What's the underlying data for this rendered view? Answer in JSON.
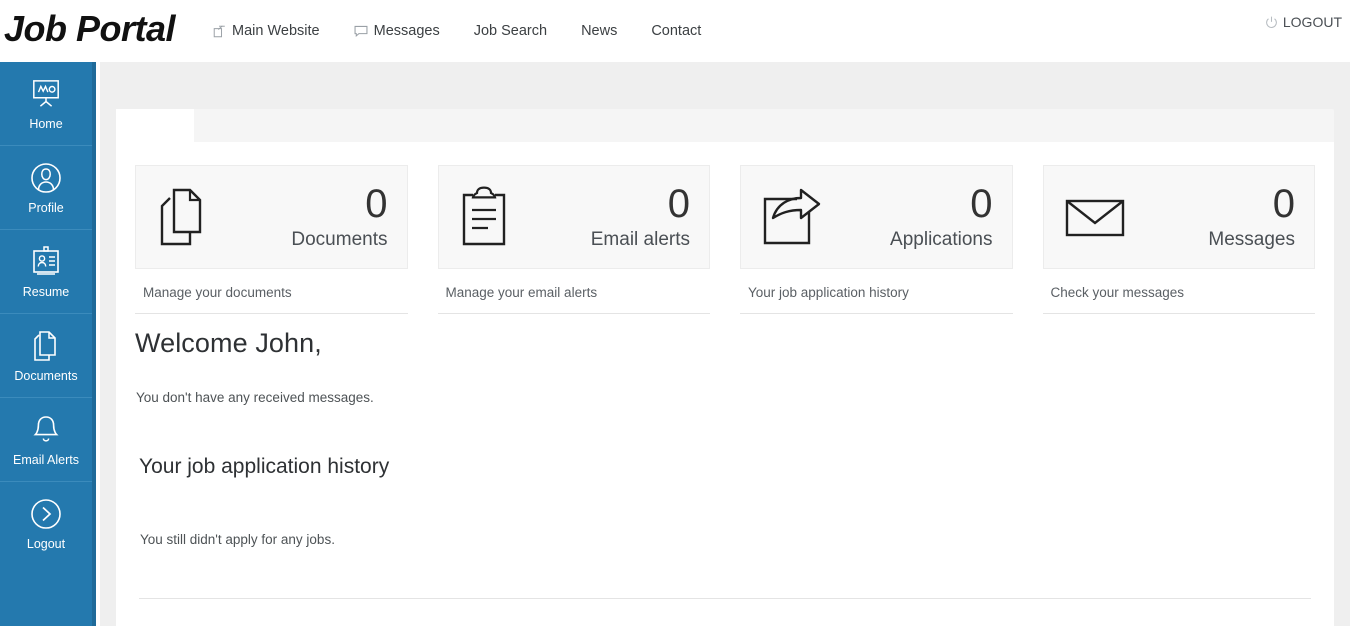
{
  "header": {
    "brand": "Job Portal",
    "nav": [
      {
        "label": "Main Website",
        "icon": "external-window-icon",
        "has_icon": true
      },
      {
        "label": "Messages",
        "icon": "comment-bubble-icon",
        "has_icon": true
      },
      {
        "label": "Job Search",
        "icon": "",
        "has_icon": false
      },
      {
        "label": "News",
        "icon": "",
        "has_icon": false
      },
      {
        "label": "Contact",
        "icon": "",
        "has_icon": false
      }
    ],
    "logout": {
      "label": "LOGOUT",
      "icon": "power-icon"
    }
  },
  "sidebar": {
    "background_color": "#2479ae",
    "items": [
      {
        "label": "Home",
        "icon": "presentation-board-icon"
      },
      {
        "label": "Profile",
        "icon": "user-circle-icon"
      },
      {
        "label": "Resume",
        "icon": "id-badge-icon"
      },
      {
        "label": "Documents",
        "icon": "documents-stack-icon"
      },
      {
        "label": "Email Alerts",
        "icon": "bell-icon"
      },
      {
        "label": "Logout",
        "icon": "arrow-right-circle-icon"
      }
    ]
  },
  "tabs": [
    {
      "label": "",
      "active": true
    }
  ],
  "stats": [
    {
      "count": "0",
      "name": "Documents",
      "subtitle": "Manage your documents",
      "icon": "documents-stack-icon"
    },
    {
      "count": "0",
      "name": "Email alerts",
      "subtitle": "Manage your email alerts",
      "icon": "clipboard-lines-icon"
    },
    {
      "count": "0",
      "name": "Applications",
      "subtitle": "Your job application history",
      "icon": "share-arrow-icon"
    },
    {
      "count": "0",
      "name": "Messages",
      "subtitle": "Check your messages",
      "icon": "envelope-icon"
    }
  ],
  "main": {
    "welcome": "Welcome John,",
    "messages_empty": "You don't have any received messages.",
    "section_title": "Your job application history",
    "applications_empty": "You still didn't apply for any jobs."
  },
  "colors": {
    "sidebar_blue": "#2479ae",
    "sidebar_edge": "#1f6a99",
    "page_bg": "#efefef",
    "card_bg": "#f8f8f8"
  }
}
